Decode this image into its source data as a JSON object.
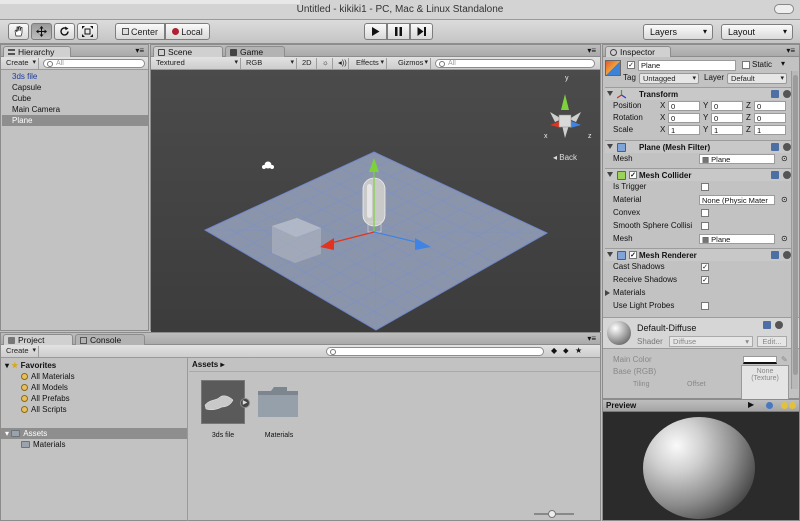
{
  "window": {
    "title": "Untitled - kikiki1 - PC, Mac & Linux Standalone"
  },
  "toolbar": {
    "pivot_label": "Center",
    "space_label": "Local",
    "layers_label": "Layers",
    "layout_label": "Layout",
    "tools": [
      "hand-tool",
      "move-tool",
      "rotate-tool",
      "scale-tool"
    ]
  },
  "hierarchy": {
    "tab_label": "Hierarchy",
    "create_label": "Create",
    "search_placeholder": "All",
    "items": [
      {
        "label": "3ds file",
        "kind": "prefab"
      },
      {
        "label": "Capsule",
        "kind": "object"
      },
      {
        "label": "Cube",
        "kind": "object"
      },
      {
        "label": "Main Camera",
        "kind": "object"
      },
      {
        "label": "Plane",
        "kind": "selected"
      }
    ]
  },
  "scene": {
    "tabs": [
      {
        "label": "Scene"
      },
      {
        "label": "Game"
      }
    ],
    "shading_mode": "Textured",
    "render_mode": "RGB",
    "mode_2d": "2D",
    "effects_label": "Effects",
    "gizmos_label": "Gizmos",
    "search_placeholder": "All",
    "view_label": "Back",
    "axes": {
      "x": "x",
      "y": "y",
      "z": "z"
    },
    "colors": {
      "background": "#434343",
      "plane": "#8a96ad",
      "grid": "#6f86c7",
      "y_axis": "#7fd13b",
      "x_axis": "#e0341f",
      "z_axis": "#3f84e5"
    }
  },
  "inspector": {
    "tab_label": "Inspector",
    "object_name": "Plane",
    "static_label": "Static",
    "tag_label": "Tag",
    "tag_value": "Untagged",
    "layer_label": "Layer",
    "layer_value": "Default",
    "transform": {
      "title": "Transform",
      "position_label": "Position",
      "rotation_label": "Rotation",
      "scale_label": "Scale",
      "position": {
        "x": "0",
        "y": "0",
        "z": "0"
      },
      "rotation": {
        "x": "0",
        "y": "0",
        "z": "0"
      },
      "scale": {
        "x": "1",
        "y": "1",
        "z": "1"
      }
    },
    "mesh_filter": {
      "title": "Plane (Mesh Filter)",
      "mesh_label": "Mesh",
      "mesh_value": "Plane"
    },
    "mesh_collider": {
      "title": "Mesh Collider",
      "is_trigger_label": "Is Trigger",
      "material_label": "Material",
      "material_value": "None (Physic Mater",
      "convex_label": "Convex",
      "smooth_label": "Smooth Sphere Collisi",
      "mesh_label": "Mesh",
      "mesh_value": "Plane"
    },
    "mesh_renderer": {
      "title": "Mesh Renderer",
      "cast_shadows_label": "Cast Shadows",
      "receive_shadows_label": "Receive Shadows",
      "materials_label": "Materials",
      "light_probes_label": "Use Light Probes"
    },
    "material": {
      "title": "Default-Diffuse",
      "shader_label": "Shader",
      "shader_value": "Diffuse",
      "edit_label": "Edit...",
      "main_color_label": "Main Color",
      "base_label": "Base (RGB)",
      "tiling_label": "Tiling",
      "offset_label": "Offset",
      "texture_value": "None\n(Texture)"
    },
    "preview_label": "Preview"
  },
  "project": {
    "tabs": [
      {
        "label": "Project"
      },
      {
        "label": "Console"
      }
    ],
    "create_label": "Create",
    "favorites_label": "Favorites",
    "favorites": [
      "All Materials",
      "All Models",
      "All Prefabs",
      "All Scripts"
    ],
    "assets_label": "Assets",
    "asset_folders": [
      "Materials"
    ],
    "breadcrumb": "Assets",
    "grid_items": [
      {
        "label": "3ds file"
      },
      {
        "label": "Materials"
      }
    ]
  }
}
